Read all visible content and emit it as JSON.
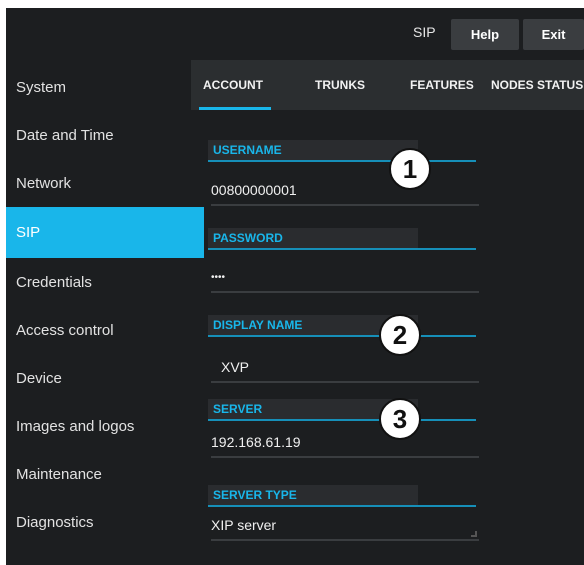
{
  "topbar": {
    "title": "SIP",
    "help_label": "Help",
    "exit_label": "Exit"
  },
  "sidebar": {
    "items": [
      {
        "label": "System"
      },
      {
        "label": "Date and Time"
      },
      {
        "label": "Network"
      },
      {
        "label": "SIP",
        "active": true
      },
      {
        "label": "Credentials"
      },
      {
        "label": "Access control"
      },
      {
        "label": "Device"
      },
      {
        "label": "Images and logos"
      },
      {
        "label": "Maintenance"
      },
      {
        "label": "Diagnostics"
      }
    ]
  },
  "tabs": [
    {
      "label": "ACCOUNT",
      "active": true
    },
    {
      "label": "TRUNKS"
    },
    {
      "label": "FEATURES"
    },
    {
      "label": "NODES STATUS"
    }
  ],
  "form": {
    "username": {
      "label": "USERNAME",
      "value": "00800000001"
    },
    "password": {
      "label": "PASSWORD",
      "value": "••••"
    },
    "display_name": {
      "label": "DISPLAY NAME",
      "value": "XVP"
    },
    "server": {
      "label": "SERVER",
      "value": "192.168.61.19"
    },
    "server_type": {
      "label": "SERVER TYPE",
      "value": "XIP server"
    }
  },
  "callouts": [
    "1",
    "2",
    "3"
  ],
  "colors": {
    "accent": "#19b6ea",
    "background": "#1c1e20",
    "tabbar": "#2b2e30"
  }
}
